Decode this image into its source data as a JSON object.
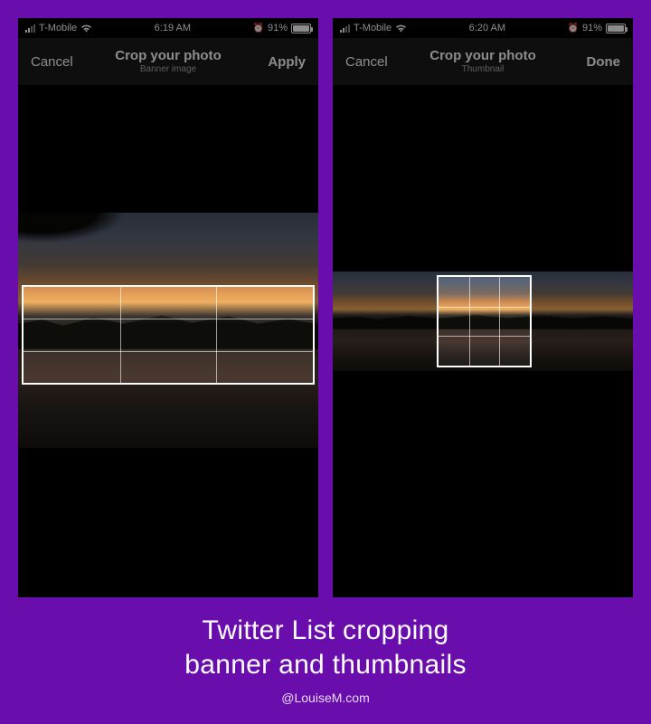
{
  "colors": {
    "background": "#6a0dad",
    "phone_bg": "#000000",
    "nav_bg": "#1b1b1d"
  },
  "phones": [
    {
      "status": {
        "carrier": "T-Mobile",
        "time": "6:19 AM",
        "battery_pct": "91%",
        "alarm_set": true
      },
      "nav": {
        "left": "Cancel",
        "title": "Crop your photo",
        "subtitle": "Banner image",
        "right": "Apply"
      },
      "crop": {
        "aspect_label": "banner (3:1)"
      }
    },
    {
      "status": {
        "carrier": "T-Mobile",
        "time": "6:20 AM",
        "battery_pct": "91%",
        "alarm_set": true
      },
      "nav": {
        "left": "Cancel",
        "title": "Crop your photo",
        "subtitle": "Thumbnail",
        "right": "Done"
      },
      "crop": {
        "aspect_label": "thumbnail (1:1)"
      }
    }
  ],
  "caption": {
    "line1": "Twitter List cropping",
    "line2": "banner and thumbnails",
    "credit": "@LouiseM.com"
  }
}
